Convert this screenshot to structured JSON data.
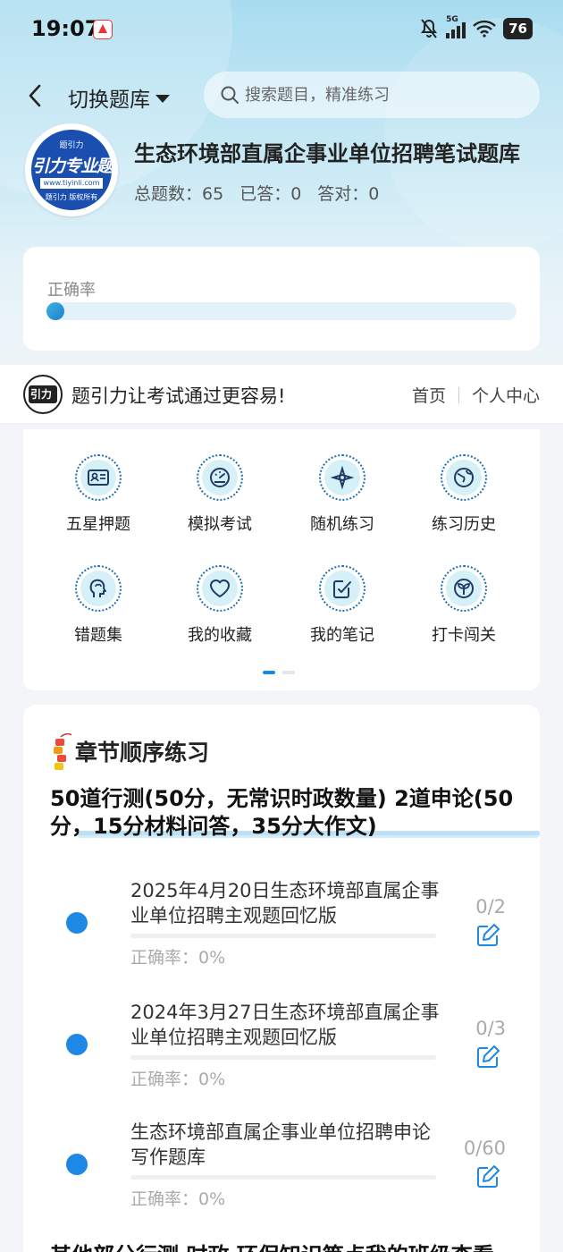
{
  "status_bar": {
    "time": "19:07",
    "signal_label": "5G",
    "battery": "76"
  },
  "header": {
    "switch_bank_label": "切换题库",
    "search_placeholder": "搜索题目，精准练习"
  },
  "bank": {
    "logo_top": "题引力",
    "logo_main": "引力专业题",
    "logo_url": "www.tiyinli.com",
    "logo_copyright": "题引力 版权所有",
    "title": "生态环境部直属企事业单位招聘笔试题库",
    "stats": {
      "total": "总题数：65",
      "answered": "已答：0",
      "correct": "答对：0"
    }
  },
  "accuracy": {
    "label": "正确率",
    "value": 0
  },
  "slogan": {
    "text": "题引力让考试通过更容易!",
    "nav_home": "首页",
    "nav_profile": "个人中心"
  },
  "features": [
    {
      "label": "五星押题",
      "icon": "id-card-icon"
    },
    {
      "label": "模拟考试",
      "icon": "gauge-icon"
    },
    {
      "label": "随机练习",
      "icon": "compass-icon"
    },
    {
      "label": "练习历史",
      "icon": "globe-icon"
    },
    {
      "label": "错题集",
      "icon": "brain-head-icon"
    },
    {
      "label": "我的收藏",
      "icon": "heart-icon"
    },
    {
      "label": "我的笔记",
      "icon": "note-check-icon"
    },
    {
      "label": "打卡闯关",
      "icon": "sprout-icon"
    }
  ],
  "chapters": {
    "heading": "章节顺序练习",
    "section_title": "50道行测(50分，无常识时政数量) 2道申论(50分，15分材料问答，35分大作文)",
    "items": [
      {
        "name": "2025年4月20日生态环境部直属企事业单位招聘主观题回忆版",
        "accuracy": "正确率：0%",
        "count": "0/2"
      },
      {
        "name": "2024年3月27日生态环境部直属企事业单位招聘主观题回忆版",
        "accuracy": "正确率：0%",
        "count": "0/3"
      },
      {
        "name": "生态环境部直属企事业单位招聘申论写作题库",
        "accuracy": "正确率：0%",
        "count": "0/60"
      }
    ],
    "next_section_title": "其他部分行测 时政 环保知识等点我的班级查看"
  },
  "colors": {
    "accent": "#1e88e5",
    "icon_bg": "#d6f0f7",
    "icon_stroke": "#1f6fb3"
  }
}
